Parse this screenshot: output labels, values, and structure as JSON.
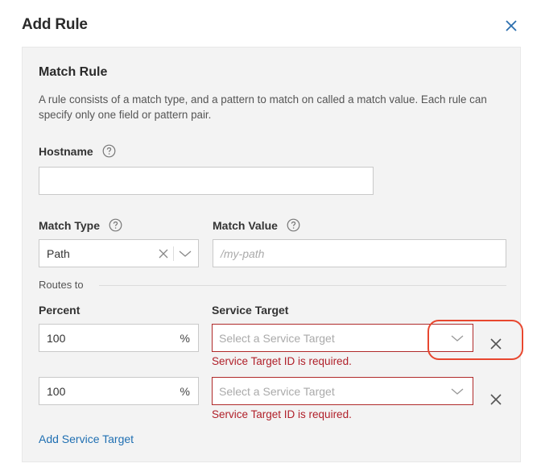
{
  "dialog": {
    "title": "Add Rule"
  },
  "match_rule": {
    "heading": "Match Rule",
    "description": "A rule consists of a match type, and a pattern to match on called a match value. Each rule can specify only one field or pattern pair.",
    "hostname": {
      "label": "Hostname",
      "value": ""
    },
    "match_type": {
      "label": "Match Type",
      "selected": "Path"
    },
    "match_value": {
      "label": "Match Value",
      "placeholder": "/my-path"
    }
  },
  "routes": {
    "label": "Routes to",
    "percent_header": "Percent",
    "service_target_header": "Service Target",
    "percent_suffix": "%",
    "rows": [
      {
        "percent": "100",
        "service_placeholder": "Select a Service Target",
        "error": "Service Target ID is required."
      },
      {
        "percent": "100",
        "service_placeholder": "Select a Service Target",
        "error": "Service Target ID is required."
      }
    ],
    "add_link": "Add Service Target"
  },
  "colors": {
    "accent": "#1f6fb2",
    "error": "#b0202a",
    "panel_bg": "#f3f3f3",
    "highlight": "#e8472f"
  },
  "icons": [
    "close-icon",
    "help-icon",
    "clear-icon",
    "chevron-down-icon",
    "remove-row-icon"
  ]
}
